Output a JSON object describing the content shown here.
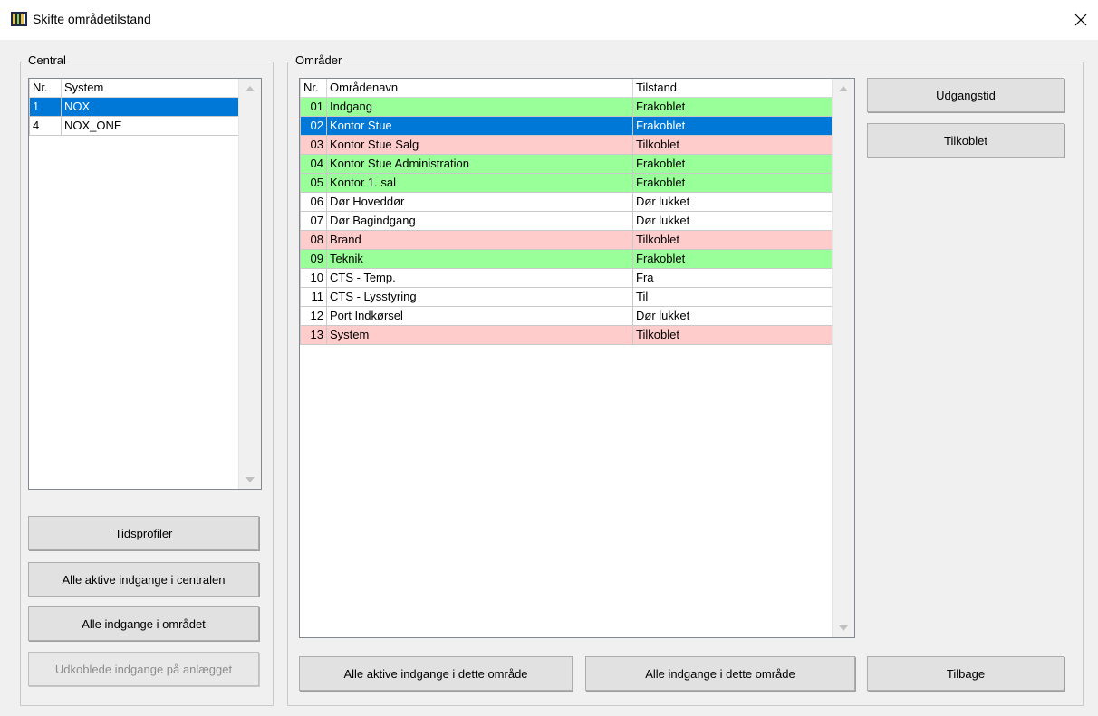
{
  "window": {
    "title": "Skifte områdetilstand"
  },
  "central": {
    "group_title": "Central",
    "columns": [
      "Nr.",
      "System"
    ],
    "rows": [
      {
        "nr": "1",
        "system": "NOX",
        "selected": true
      },
      {
        "nr": "4",
        "system": "NOX_ONE",
        "selected": false
      }
    ],
    "buttons": {
      "tidsprofiler": "Tidsprofiler",
      "alle_aktive_centralen": "Alle aktive indgange i centralen",
      "alle_omraadet": "Alle indgange i området",
      "udkoblede": "Udkoblede indgange på anlægget"
    }
  },
  "omraader": {
    "group_title": "Områder",
    "columns": [
      "Nr.",
      "Områdenavn",
      "Tilstand"
    ],
    "rows": [
      {
        "nr": "01",
        "name": "Indgang",
        "state": "Frakoblet",
        "color": "green"
      },
      {
        "nr": "02",
        "name": "Kontor Stue",
        "state": "Frakoblet",
        "color": "selected"
      },
      {
        "nr": "03",
        "name": "Kontor Stue Salg",
        "state": "Tilkoblet",
        "color": "red"
      },
      {
        "nr": "04",
        "name": "Kontor Stue Administration",
        "state": "Frakoblet",
        "color": "green"
      },
      {
        "nr": "05",
        "name": "Kontor 1. sal",
        "state": "Frakoblet",
        "color": "green"
      },
      {
        "nr": "06",
        "name": "Dør Hoveddør",
        "state": "Dør lukket",
        "color": "white"
      },
      {
        "nr": "07",
        "name": "Dør Bagindgang",
        "state": "Dør lukket",
        "color": "white"
      },
      {
        "nr": "08",
        "name": "Brand",
        "state": "Tilkoblet",
        "color": "red"
      },
      {
        "nr": "09",
        "name": "Teknik",
        "state": "Frakoblet",
        "color": "green"
      },
      {
        "nr": "10",
        "name": "CTS - Temp.",
        "state": "Fra",
        "color": "white"
      },
      {
        "nr": "11",
        "name": "CTS - Lysstyring",
        "state": "Til",
        "color": "white"
      },
      {
        "nr": "12",
        "name": "Port Indkørsel",
        "state": "Dør lukket",
        "color": "white"
      },
      {
        "nr": "13",
        "name": "System",
        "state": "Tilkoblet",
        "color": "red"
      }
    ],
    "buttons": {
      "udgangstid": "Udgangstid",
      "tilkoblet": "Tilkoblet",
      "alle_aktive_omraade": "Alle aktive indgange i dette område",
      "alle_omraade": "Alle indgange i dette område",
      "tilbage": "Tilbage"
    }
  },
  "colors": {
    "green": "#99ff99",
    "red": "#ffcccc",
    "selected": "#0078d7",
    "white": "#ffffff"
  }
}
